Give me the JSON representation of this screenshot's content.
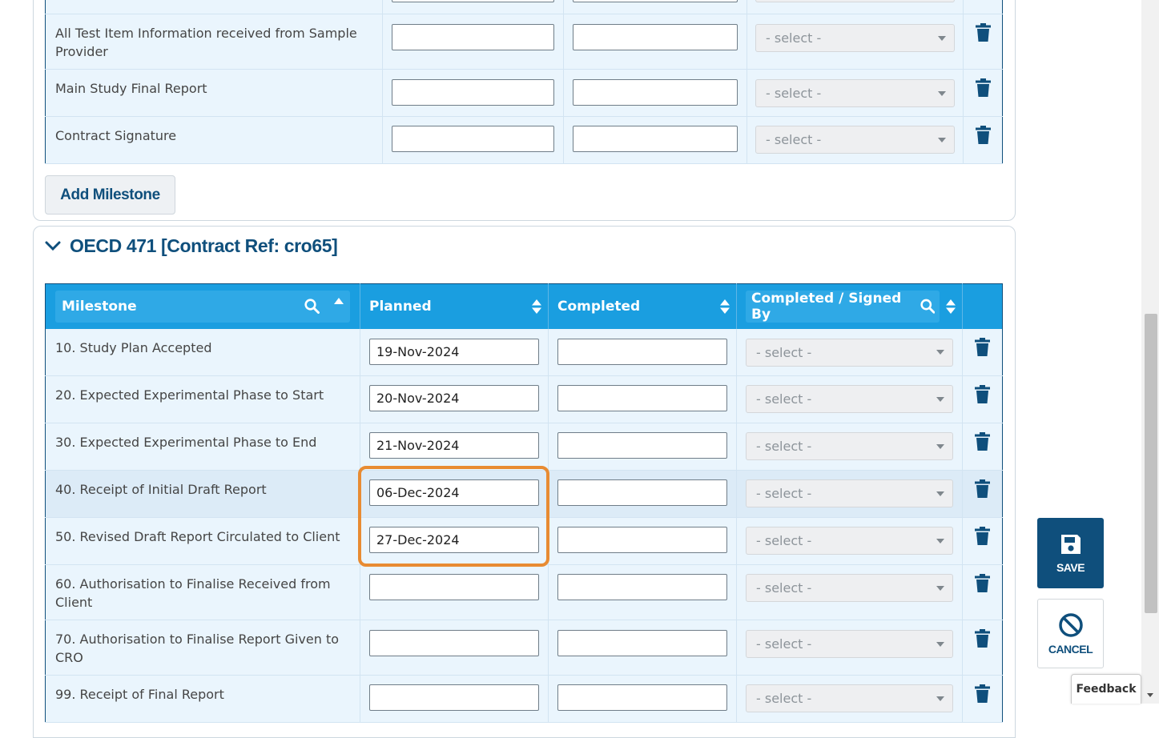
{
  "top_table": {
    "rows": [
      {
        "milestone": "All Test Item Information received from Sample Provider",
        "planned": "",
        "completed": "",
        "signed_by": "- select -"
      },
      {
        "milestone": "Main Study Final Report",
        "planned": "",
        "completed": "",
        "signed_by": "- select -"
      },
      {
        "milestone": "Contract Signature",
        "planned": "",
        "completed": "",
        "signed_by": "- select -"
      }
    ],
    "add_milestone_label": "Add Milestone"
  },
  "section": {
    "title": "OECD 471 [Contract Ref: cro65]",
    "headers": {
      "milestone": "Milestone",
      "planned": "Planned",
      "completed": "Completed",
      "signed_by": "Completed / Signed By"
    },
    "rows": [
      {
        "milestone": "10. Study Plan Accepted",
        "planned": "19-Nov-2024",
        "completed": "",
        "signed_by": "- select -"
      },
      {
        "milestone": "20. Expected Experimental Phase to Start",
        "planned": "20-Nov-2024",
        "completed": "",
        "signed_by": "- select -"
      },
      {
        "milestone": "30. Expected Experimental Phase to End",
        "planned": "21-Nov-2024",
        "completed": "",
        "signed_by": "- select -"
      },
      {
        "milestone": "40. Receipt of Initial Draft Report",
        "planned": "06-Dec-2024",
        "completed": "",
        "signed_by": "- select -"
      },
      {
        "milestone": "50. Revised Draft Report Circulated to Client",
        "planned": "27-Dec-2024",
        "completed": "",
        "signed_by": "- select -"
      },
      {
        "milestone": "60. Authorisation to Finalise Received from Client",
        "planned": "",
        "completed": "",
        "signed_by": "- select -"
      },
      {
        "milestone": "70. Authorisation to Finalise Report Given to CRO",
        "planned": "",
        "completed": "",
        "signed_by": "- select -"
      },
      {
        "milestone": "99. Receipt of Final Report",
        "planned": "",
        "completed": "",
        "signed_by": "- select -"
      }
    ]
  },
  "actions": {
    "save_label": "SAVE",
    "cancel_label": "CANCEL"
  },
  "feedback_label": "Feedback",
  "colors": {
    "header_bg": "#1a9ee0",
    "brand": "#0f4f7c",
    "highlight": "#e88b32",
    "row_bg": "#eaf5fd"
  }
}
